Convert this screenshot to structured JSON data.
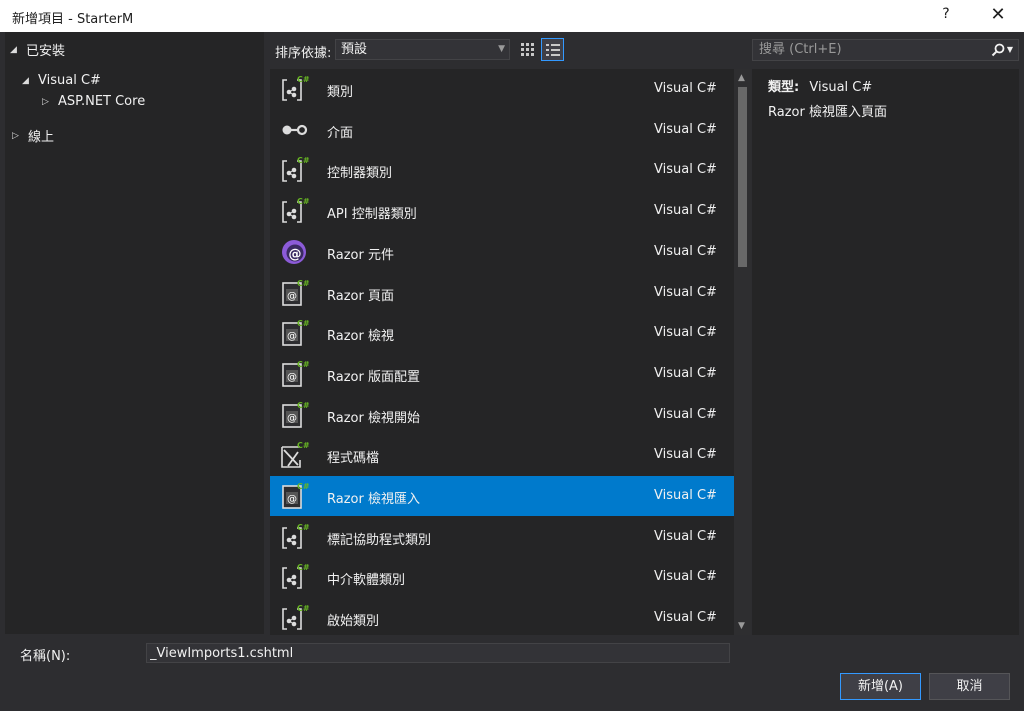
{
  "window": {
    "title": "新增項目 - StarterM",
    "help": "?",
    "close": "✕"
  },
  "tree": {
    "installed": "已安裝",
    "visual_csharp": "Visual C#",
    "aspnet_core": "ASP.NET Core",
    "online": "線上"
  },
  "toolbar": {
    "sort_label": "排序依據:",
    "sort_value": "預設",
    "search_placeholder": "搜尋 (Ctrl+E)"
  },
  "items": [
    {
      "name": "類別",
      "lang": "Visual C#",
      "icon": "class-icon"
    },
    {
      "name": "介面",
      "lang": "Visual C#",
      "icon": "interface-icon"
    },
    {
      "name": "控制器類別",
      "lang": "Visual C#",
      "icon": "class-icon"
    },
    {
      "name": "API 控制器類別",
      "lang": "Visual C#",
      "icon": "class-icon"
    },
    {
      "name": "Razor 元件",
      "lang": "Visual C#",
      "icon": "razor-component-icon"
    },
    {
      "name": "Razor 頁面",
      "lang": "Visual C#",
      "icon": "razor-page-icon"
    },
    {
      "name": "Razor 檢視",
      "lang": "Visual C#",
      "icon": "razor-page-icon"
    },
    {
      "name": "Razor 版面配置",
      "lang": "Visual C#",
      "icon": "razor-page-icon"
    },
    {
      "name": "Razor 檢視開始",
      "lang": "Visual C#",
      "icon": "razor-page-icon"
    },
    {
      "name": "程式碼檔",
      "lang": "Visual C#",
      "icon": "code-file-icon"
    },
    {
      "name": "Razor 檢視匯入",
      "lang": "Visual C#",
      "icon": "razor-page-icon",
      "selected": true
    },
    {
      "name": "標記協助程式類別",
      "lang": "Visual C#",
      "icon": "class-icon"
    },
    {
      "name": "中介軟體類別",
      "lang": "Visual C#",
      "icon": "class-icon"
    },
    {
      "name": "啟始類別",
      "lang": "Visual C#",
      "icon": "class-icon"
    }
  ],
  "details": {
    "type_label": "類型:",
    "type_value": "Visual C#",
    "description": "Razor 檢視匯入頁面"
  },
  "footer": {
    "name_label": "名稱(N):",
    "name_value": "_ViewImports1.cshtml",
    "add_button": "新增(A)",
    "cancel_button": "取消"
  },
  "colors": {
    "background": "#2d2d30",
    "panel": "#252526",
    "selection": "#007acc",
    "csharp_green": "#68b723",
    "razor_purple": "#8c5bd8"
  }
}
